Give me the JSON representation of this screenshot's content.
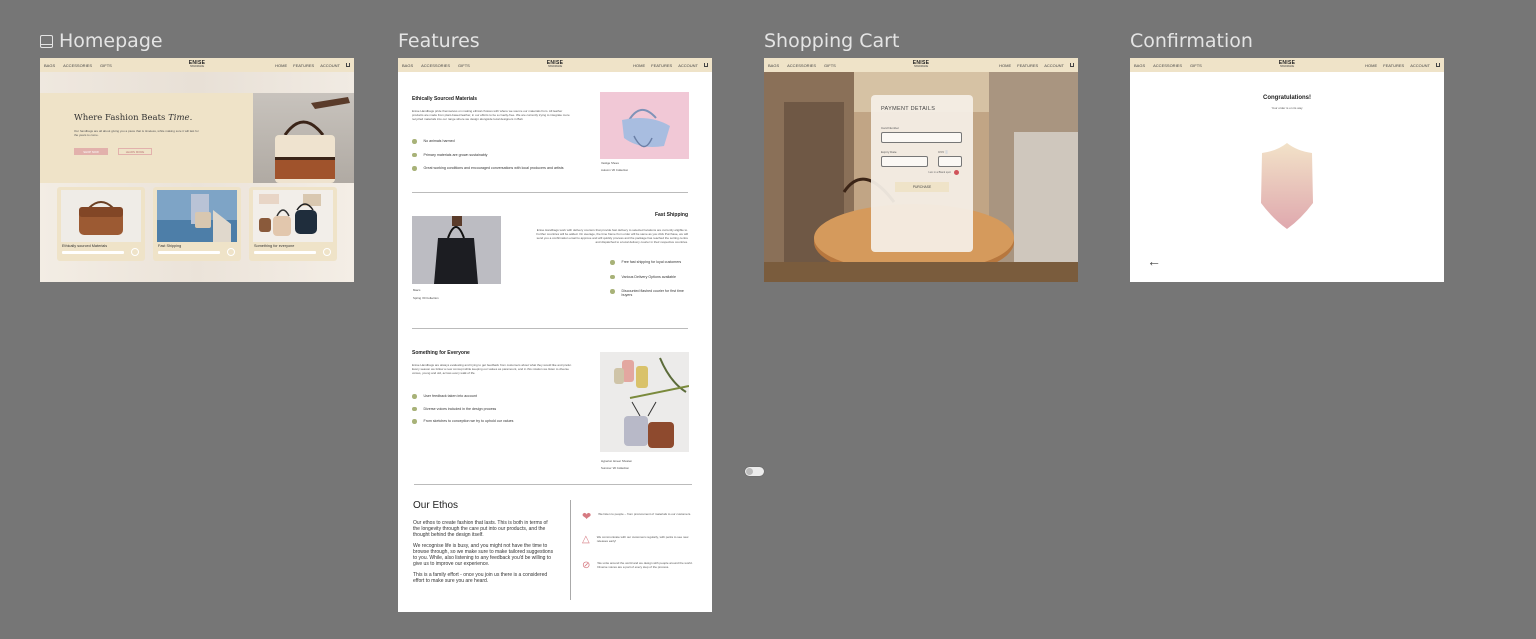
{
  "frames": {
    "homepage": "Homepage",
    "features": "Features",
    "cart": "Shopping Cart",
    "confirmation": "Confirmation"
  },
  "nav": {
    "left": [
      "BAGS",
      "ACCESSORIES",
      "GIFTS"
    ],
    "logo": "ENISE",
    "logo_sub": "HANDMADE",
    "right": [
      "HOME",
      "FEATURES",
      "ACCOUNT"
    ]
  },
  "home": {
    "hero_title": "Where Fashion Beats",
    "hero_title_italic": "Time.",
    "hero_text": "Our handbags are all about giving you a piece that is timeless, while making sure it will last for the years to come.",
    "btn_primary": "SHOP NOW",
    "btn_secondary": "LEARN MORE",
    "cards": [
      "Ethically sourced Materials",
      "Fast Shipping",
      "Something for everyone"
    ]
  },
  "features": {
    "s1_title": "Ethically Sourced Materials",
    "s1_text": "Enise Handbags pride themselves on making ethical choices with where we source our materials from. All leather products are made from plant-based leather, in our efforts to be a cruelty-free. We are currently trying to integrate more recycled materials into our range where we design alongside local designers in Bali.",
    "s1_bullets": [
      "No animals harmed",
      "Primary materials are grown sustainably",
      "Great working conditions and encouraged conversations with local producers and artists"
    ],
    "s1_caption": "Vestige Shoes",
    "s1_caption2": "Autumn '20 Collection",
    "s2_title": "Fast Shipping",
    "s2_text": "Enise Handbags work with delivery couriers that provide fast delivery to selected locations are currently eligible to. Further countries will be added. On average, the time frame from order will be same as you click Purchase, we will send you a confirmation email to approve and will quickly process and the package has reached the sorting centre and dispatched to a local delivery courier in their respective countries.",
    "s2_bullets": [
      "Free fast shipping for loyal customers",
      "Various Delivery Options available",
      "Discounted flashed courier for first time buyers"
    ],
    "s2_caption": "Mae's",
    "s2_caption2": "Spring '20 Collection",
    "s3_title": "Something for Everyone",
    "s3_text": "Enise Handbags are always evaluating and trying to get feedback from customers about what they would like and prefer. Every season we follow a new concept while keeping our values as paramount, and in this rotation we listen to diverse voices, young and old, across every walk of life.",
    "s3_bullets": [
      "User feedback taken into account",
      "Diverse voices included in the design process",
      "From sketches to conception we try to uphold our values"
    ],
    "s3_caption": "Hyperion Ameer Shosten",
    "s3_caption2": "Summer '20 Collection",
    "ethos_title": "Our Ethos",
    "ethos_p1": "Our ethos to create fashion that lasts. This is both in terms of the longevity through the care put into our products, and the thought behind the design itself.",
    "ethos_p2": "We recognise life is busy, and you might not have the time to browse through, so we make sure to make tailored suggestions to you. While, also listening to any feedback you'd be willing to give us to improve our experience.",
    "ethos_p3": "This is a family effort - once you join us there is a considered effort to make sure you are heard.",
    "ethos_items": [
      "We listen to people – from procurement of materials to our customers.",
      "We communicate with our customers regularly, with perks to see new releases early!",
      "We unite around the world and we design with people around the world. Diverse voices are a part of every step of the process."
    ]
  },
  "cart": {
    "title": "PAYMENT DETAILS",
    "card_label": "Card Number",
    "expiry_label": "Expiry Date",
    "cvv_label": "CVV",
    "save_label": "I am in a Blank spot",
    "purchase": "PURCHASE"
  },
  "confirmation": {
    "title": "Congratulations!",
    "subtitle": "Your order is on its way"
  },
  "colors": {
    "nav": "#efe3c8",
    "accent": "#e2b1ac",
    "bullet": "#a8b278",
    "canvas": "#767676"
  }
}
